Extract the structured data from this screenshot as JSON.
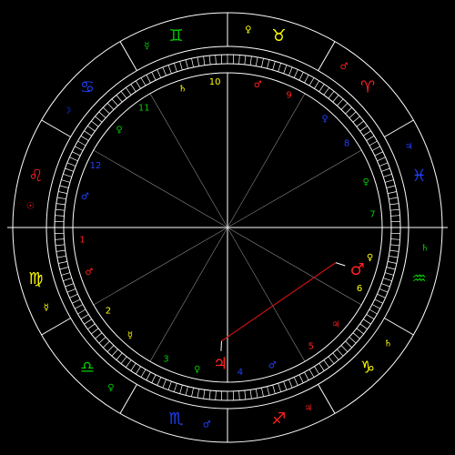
{
  "colors": {
    "background": "#000000",
    "line": "#ffffff",
    "fire": "#ff2020",
    "earth": "#ffff00",
    "air": "#00cc00",
    "water": "#2040ff",
    "aspect": "#cc1111"
  },
  "zodiac": [
    {
      "key": "virgo",
      "glyph": "♍",
      "lon": 155,
      "ruler": "☿",
      "element": "earth"
    },
    {
      "key": "libra",
      "glyph": "♎",
      "lon": 185,
      "ruler": "♀",
      "element": "air"
    },
    {
      "key": "scorpio",
      "glyph": "♏",
      "lon": 215,
      "ruler": "♂",
      "element": "water"
    },
    {
      "key": "sagittarius",
      "glyph": "♐",
      "lon": 245,
      "ruler": "♃",
      "element": "fire"
    },
    {
      "key": "capricorn",
      "glyph": "♑",
      "lon": 275,
      "ruler": "♄",
      "element": "earth"
    },
    {
      "key": "aquarius",
      "glyph": "♒",
      "lon": 305,
      "ruler": "♄",
      "element": "air"
    },
    {
      "key": "pisces",
      "glyph": "♓",
      "lon": 335,
      "ruler": "♃",
      "element": "water"
    },
    {
      "key": "aries",
      "glyph": "♈",
      "lon": 5,
      "ruler": "♂",
      "element": "fire"
    },
    {
      "key": "taurus",
      "glyph": "♉",
      "lon": 35,
      "ruler": "♀",
      "element": "earth"
    },
    {
      "key": "gemini",
      "glyph": "♊",
      "lon": 65,
      "ruler": "☿",
      "element": "air"
    },
    {
      "key": "cancer",
      "glyph": "♋",
      "lon": 95,
      "ruler": "☽",
      "element": "water"
    },
    {
      "key": "leo",
      "glyph": "♌",
      "lon": 125,
      "ruler": "☉",
      "element": "fire"
    }
  ],
  "sign_boundaries": [
    140,
    170,
    200,
    230,
    260,
    290,
    320,
    350,
    20,
    50,
    80,
    110
  ],
  "houses": [
    {
      "number": "1",
      "cusp": 140,
      "ruler": "♂",
      "element": "fire"
    },
    {
      "number": "2",
      "cusp": 170,
      "ruler": "☿",
      "element": "earth"
    },
    {
      "number": "3",
      "cusp": 200,
      "ruler": "♀",
      "element": "air"
    },
    {
      "number": "4",
      "cusp": 230,
      "ruler": "♂",
      "element": "water"
    },
    {
      "number": "5",
      "cusp": 260,
      "ruler": "♃",
      "element": "fire"
    },
    {
      "number": "6",
      "cusp": 290,
      "ruler": "♀",
      "element": "earth"
    },
    {
      "number": "7",
      "cusp": 320,
      "ruler": "♀",
      "element": "air"
    },
    {
      "number": "8",
      "cusp": 350,
      "ruler": "♀",
      "element": "water"
    },
    {
      "number": "9",
      "cusp": 20,
      "ruler": "♂",
      "element": "fire"
    },
    {
      "number": "10",
      "cusp": 50,
      "ruler": "♄",
      "element": "earth"
    },
    {
      "number": "11",
      "cusp": 80,
      "ruler": "♀",
      "element": "air"
    },
    {
      "number": "12",
      "cusp": 110,
      "ruler": "♂",
      "element": "water"
    }
  ],
  "ascendant": 140,
  "midheaven": 50,
  "planets": [
    {
      "key": "mars",
      "glyph": "♂",
      "lon": 302,
      "element": "fire"
    },
    {
      "key": "jupiter",
      "glyph": "♃",
      "lon": 227,
      "element": "fire"
    }
  ],
  "aspects": [
    {
      "from": "mars",
      "to": "jupiter",
      "kind": "square"
    }
  ]
}
